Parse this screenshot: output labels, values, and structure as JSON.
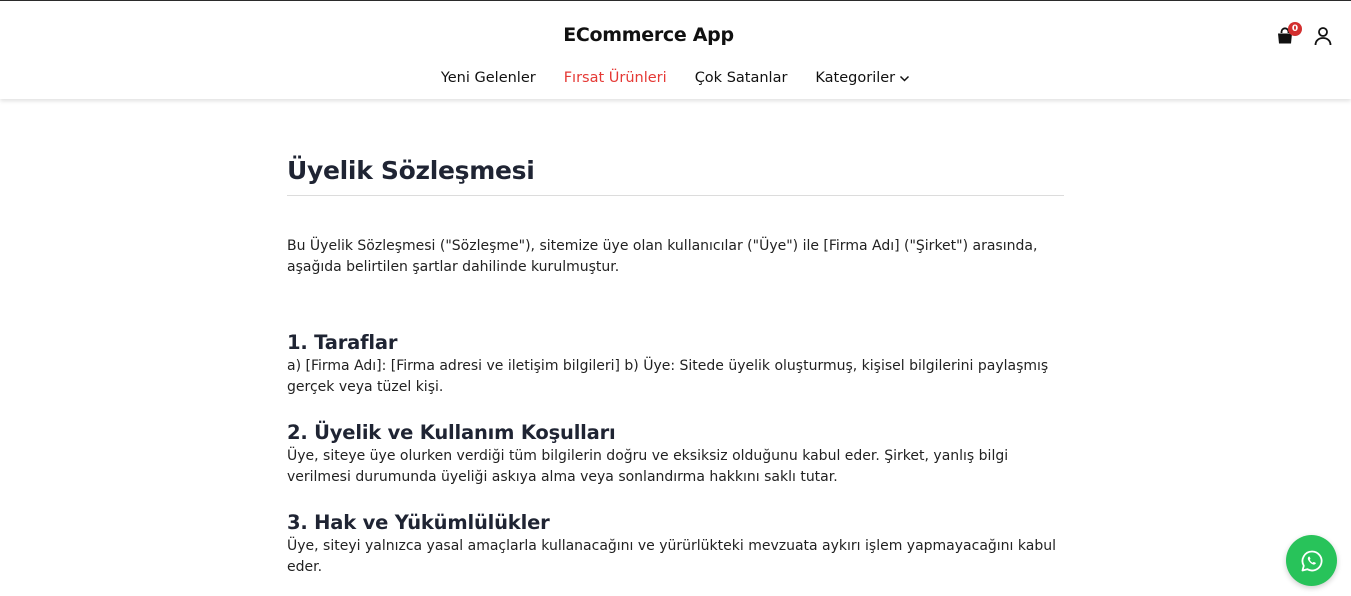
{
  "header": {
    "brand": "ECommerce App",
    "cart_count": "0"
  },
  "nav": {
    "items": [
      {
        "label": "Yeni Gelenler"
      },
      {
        "label": "Fırsat Ürünleri"
      },
      {
        "label": "Çok Satanlar"
      },
      {
        "label": "Kategoriler"
      }
    ]
  },
  "content": {
    "title": "Üyelik Sözleşmesi",
    "intro": "Bu Üyelik Sözleşmesi (\"Sözleşme\"), sitemize üye olan kullanıcılar (\"Üye\") ile [Firma Adı] (\"Şirket\") arasında, aşağıda belirtilen şartlar dahilinde kurulmuştur.",
    "sections": [
      {
        "heading": "1. Taraflar",
        "body": "a) [Firma Adı]: [Firma adresi ve iletişim bilgileri] b) Üye: Sitede üyelik oluşturmuş, kişisel bilgilerini paylaşmış gerçek veya tüzel kişi."
      },
      {
        "heading": "2. Üyelik ve Kullanım Koşulları",
        "body": "Üye, siteye üye olurken verdiği tüm bilgilerin doğru ve eksiksiz olduğunu kabul eder. Şirket, yanlış bilgi verilmesi durumunda üyeliği askıya alma veya sonlandırma hakkını saklı tutar."
      },
      {
        "heading": "3. Hak ve Yükümlülükler",
        "body": "Üye, siteyi yalnızca yasal amaçlarla kullanacağını ve yürürlükteki mevzuata aykırı işlem yapmayacağını kabul eder."
      }
    ]
  },
  "icons": {
    "cart": "shopping-bag-icon",
    "user": "user-icon",
    "chevron": "chevron-down-icon",
    "whatsapp": "whatsapp-icon"
  },
  "colors": {
    "active_nav": "#e53935",
    "badge": "#d32f2f",
    "whatsapp": "#28c35a"
  }
}
